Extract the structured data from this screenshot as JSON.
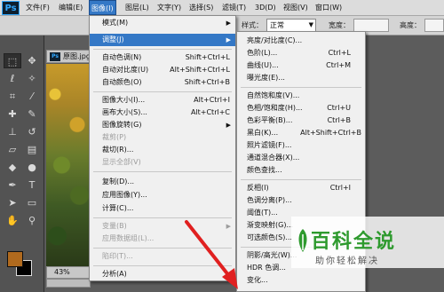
{
  "app": {
    "logo": "Ps",
    "menubar": [
      "文件(F)",
      "编辑(E)",
      "图像(I)",
      "图层(L)",
      "文字(Y)",
      "选择(S)",
      "滤镜(T)",
      "3D(D)",
      "视图(V)",
      "窗口(W)"
    ]
  },
  "options": {
    "style_label": "样式：",
    "style_value": "正常",
    "width_label": "宽度：",
    "height_label": "高度："
  },
  "document": {
    "tab_icon": "Ps",
    "tab_title": "原图.jpg",
    "zoom": "43%"
  },
  "image_menu": {
    "items": [
      {
        "label": "模式(M)",
        "shortcut": "",
        "sub": true
      },
      {
        "label": "调整(J)",
        "shortcut": "",
        "sub": true
      },
      {
        "label": "自动色调(N)",
        "shortcut": "Shift+Ctrl+L"
      },
      {
        "label": "自动对比度(U)",
        "shortcut": "Alt+Shift+Ctrl+L"
      },
      {
        "label": "自动颜色(O)",
        "shortcut": "Shift+Ctrl+B"
      },
      {
        "label": "图像大小(I)...",
        "shortcut": "Alt+Ctrl+I"
      },
      {
        "label": "画布大小(S)...",
        "shortcut": "Alt+Ctrl+C"
      },
      {
        "label": "图像旋转(G)",
        "shortcut": "",
        "sub": true
      },
      {
        "label": "裁剪(P)",
        "shortcut": ""
      },
      {
        "label": "裁切(R)...",
        "shortcut": ""
      },
      {
        "label": "显示全部(V)",
        "shortcut": ""
      },
      {
        "label": "复制(D)...",
        "shortcut": ""
      },
      {
        "label": "应用图像(Y)...",
        "shortcut": ""
      },
      {
        "label": "计算(C)...",
        "shortcut": ""
      },
      {
        "label": "变量(B)",
        "shortcut": "",
        "sub": true
      },
      {
        "label": "应用数据组(L)...",
        "shortcut": ""
      },
      {
        "label": "陷印(T)...",
        "shortcut": ""
      },
      {
        "label": "分析(A)",
        "shortcut": "",
        "sub": true
      }
    ]
  },
  "adjust_menu": {
    "items": [
      {
        "label": "亮度/对比度(C)...",
        "shortcut": ""
      },
      {
        "label": "色阶(L)...",
        "shortcut": "Ctrl+L"
      },
      {
        "label": "曲线(U)...",
        "shortcut": "Ctrl+M"
      },
      {
        "label": "曝光度(E)...",
        "shortcut": ""
      },
      {
        "label": "自然饱和度(V)...",
        "shortcut": ""
      },
      {
        "label": "色相/饱和度(H)...",
        "shortcut": "Ctrl+U"
      },
      {
        "label": "色彩平衡(B)...",
        "shortcut": "Ctrl+B"
      },
      {
        "label": "黑白(K)...",
        "shortcut": "Alt+Shift+Ctrl+B"
      },
      {
        "label": "照片滤镜(F)...",
        "shortcut": ""
      },
      {
        "label": "通道混合器(X)...",
        "shortcut": ""
      },
      {
        "label": "颜色查找...",
        "shortcut": ""
      },
      {
        "label": "反相(I)",
        "shortcut": "Ctrl+I"
      },
      {
        "label": "色调分离(P)...",
        "shortcut": ""
      },
      {
        "label": "阈值(T)...",
        "shortcut": ""
      },
      {
        "label": "渐变映射(G)...",
        "shortcut": ""
      },
      {
        "label": "可选颜色(S)...",
        "shortcut": ""
      },
      {
        "label": "阴影/高光(W)...",
        "shortcut": ""
      },
      {
        "label": "HDR 色调...",
        "shortcut": ""
      },
      {
        "label": "变化...",
        "shortcut": ""
      }
    ]
  },
  "watermark": {
    "title": "百科全说",
    "subtitle": "助你轻松解决"
  },
  "colors": {
    "accent": "#3478c6",
    "arrow": "#e02020",
    "foreground_swatch": "#b06a1e",
    "watermark_green": "#2e9a2e"
  }
}
